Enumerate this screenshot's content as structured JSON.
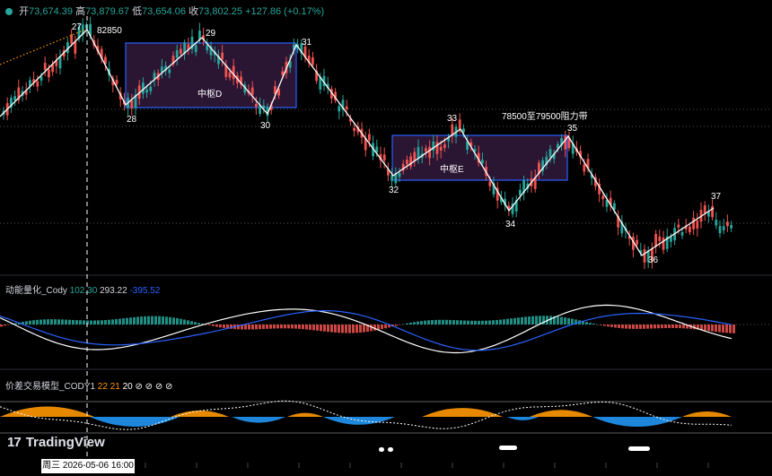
{
  "ohlc": {
    "open_label": "开",
    "open": "73,674.39",
    "high_label": "高",
    "high": "73,879.67",
    "low_label": "低",
    "low": "73,654.06",
    "close_label": "收",
    "close": "73,802.25",
    "change": "+127.86 (+0.17%)",
    "color": "#26a69a"
  },
  "indicator1": {
    "name": "动能量化_Cody",
    "values": [
      "102.30",
      "293.22",
      "-395.52"
    ],
    "colors": [
      "#26a69a",
      "#d1d4dc",
      "#2962ff"
    ]
  },
  "indicator2": {
    "name": "价差交易模型_CODY1",
    "values": [
      "22",
      "21",
      "20"
    ],
    "colors": [
      "#ff9800",
      "#ff9800",
      "#ffffff"
    ],
    "symbols": "⊘ ⊘ ⊘ ⊘"
  },
  "branding": {
    "logo": "TradingView",
    "logo_mark": "17"
  },
  "crosshair_date": "周三 2026-05-06   16:00",
  "colors": {
    "up": "#26a69a",
    "down": "#ef5350",
    "zone_fill": "#2a1533",
    "zone_border": "#2962ff",
    "zigzag": "#ffffff",
    "area_orange": "#ff9800",
    "area_blue": "#2196f3"
  },
  "chart_data": [
    {
      "type": "line",
      "name": "price with zigzag swing points",
      "zigzag_points": [
        {
          "label": "27",
          "value": 82850
        },
        {
          "label": "28"
        },
        {
          "label": "29"
        },
        {
          "label": "30"
        },
        {
          "label": "31"
        },
        {
          "label": "32"
        },
        {
          "label": "33"
        },
        {
          "label": "34"
        },
        {
          "label": "35"
        },
        {
          "label": "36"
        },
        {
          "label": "37"
        }
      ],
      "peak_annotation": "82850",
      "zones": [
        {
          "label": "中枢D"
        },
        {
          "label": "中枢E"
        }
      ],
      "annotation": "78500至79500阻力带"
    },
    {
      "type": "line",
      "name": "动能量化_Cody",
      "values": [
        "102.30",
        "293.22",
        "-395.52"
      ]
    },
    {
      "type": "area",
      "name": "价差交易模型_CODY1",
      "values": [
        "22",
        "21",
        "20"
      ]
    }
  ]
}
